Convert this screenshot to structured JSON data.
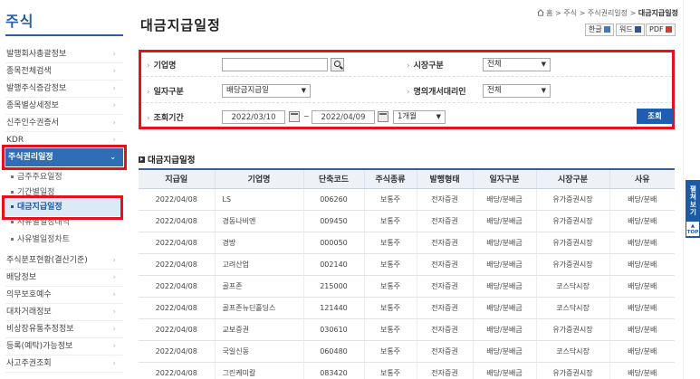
{
  "sidebar": {
    "title": "주식",
    "items_top": [
      {
        "label": "발행회사총괄정보"
      },
      {
        "label": "종목전체검색"
      },
      {
        "label": "발행주식증감정보"
      },
      {
        "label": "종목별상세정보"
      },
      {
        "label": "신주인수권증서"
      },
      {
        "label": "KDR"
      }
    ],
    "active_item": {
      "label": "주식권리일정"
    },
    "sub_items": [
      {
        "label": "금주주요일정"
      },
      {
        "label": "기간별일정"
      },
      {
        "label": "대금지급일정"
      },
      {
        "label": "사유별일정내역"
      },
      {
        "label": "사유별일정차트"
      }
    ],
    "items_bottom": [
      {
        "label": "주식분포현황(결산기준)"
      },
      {
        "label": "배당정보"
      },
      {
        "label": "의무보호예수"
      },
      {
        "label": "대차거래정보"
      },
      {
        "label": "비상장유통추정정보"
      },
      {
        "label": "등록(예탁)가능정보"
      },
      {
        "label": "사고주권조회"
      }
    ],
    "chevron": "›"
  },
  "header": {
    "page_title": "대금지급일정",
    "breadcrumb": {
      "home": "홈",
      "sep": ">",
      "level1": "주식",
      "level2": "주식권리일정",
      "current": "대금지급일정"
    },
    "buttons": {
      "hangul": "한글",
      "word": "워드",
      "pdf": "PDF"
    }
  },
  "search": {
    "company_label": "기업명",
    "company_value": "",
    "market_label": "시장구분",
    "market_value": "전체",
    "date_type_label": "일자구분",
    "date_type_value": "배당금지급일",
    "agent_label": "명의개서대리인",
    "agent_value": "전체",
    "period_label": "조회기간",
    "date_from": "2022/03/10",
    "date_sep": "~",
    "date_to": "2022/04/09",
    "period_select": "1개월",
    "query_button": "조회"
  },
  "section": {
    "title": "대금지급일정"
  },
  "table": {
    "headers": [
      "지급일",
      "기업명",
      "단축코드",
      "주식종류",
      "발행형태",
      "일자구분",
      "시장구분",
      "사유"
    ],
    "rows": [
      [
        "2022/04/08",
        "LS",
        "006260",
        "보통주",
        "전자증권",
        "배당/분배금",
        "유가증권시장",
        "배당/분배"
      ],
      [
        "2022/04/08",
        "경동나비엔",
        "009450",
        "보통주",
        "전자증권",
        "배당/분배금",
        "유가증권시장",
        "배당/분배"
      ],
      [
        "2022/04/08",
        "경방",
        "000050",
        "보통주",
        "전자증권",
        "배당/분배금",
        "유가증권시장",
        "배당/분배"
      ],
      [
        "2022/04/08",
        "고려산업",
        "002140",
        "보통주",
        "전자증권",
        "배당/분배금",
        "유가증권시장",
        "배당/분배"
      ],
      [
        "2022/04/08",
        "골프존",
        "215000",
        "보통주",
        "전자증권",
        "배당/분배금",
        "코스닥시장",
        "배당/분배"
      ],
      [
        "2022/04/08",
        "골프존뉴딘홀딩스",
        "121440",
        "보통주",
        "전자증권",
        "배당/분배금",
        "코스닥시장",
        "배당/분배"
      ],
      [
        "2022/04/08",
        "교보증권",
        "030610",
        "보통주",
        "전자증권",
        "배당/분배금",
        "유가증권시장",
        "배당/분배"
      ],
      [
        "2022/04/08",
        "국일신동",
        "060480",
        "보통주",
        "전자증권",
        "배당/분배금",
        "코스닥시장",
        "배당/분배"
      ],
      [
        "2022/04/08",
        "그린케미칼",
        "083420",
        "보통주",
        "전자증권",
        "배당/분배금",
        "유가증권시장",
        "배당/분배"
      ]
    ]
  },
  "float_tab": {
    "label": "펼쳐보기",
    "top_label": "TOP"
  },
  "colors": {
    "brand": "#2f6db5",
    "highlight": "#e8101a",
    "button": "#1e5db0"
  }
}
